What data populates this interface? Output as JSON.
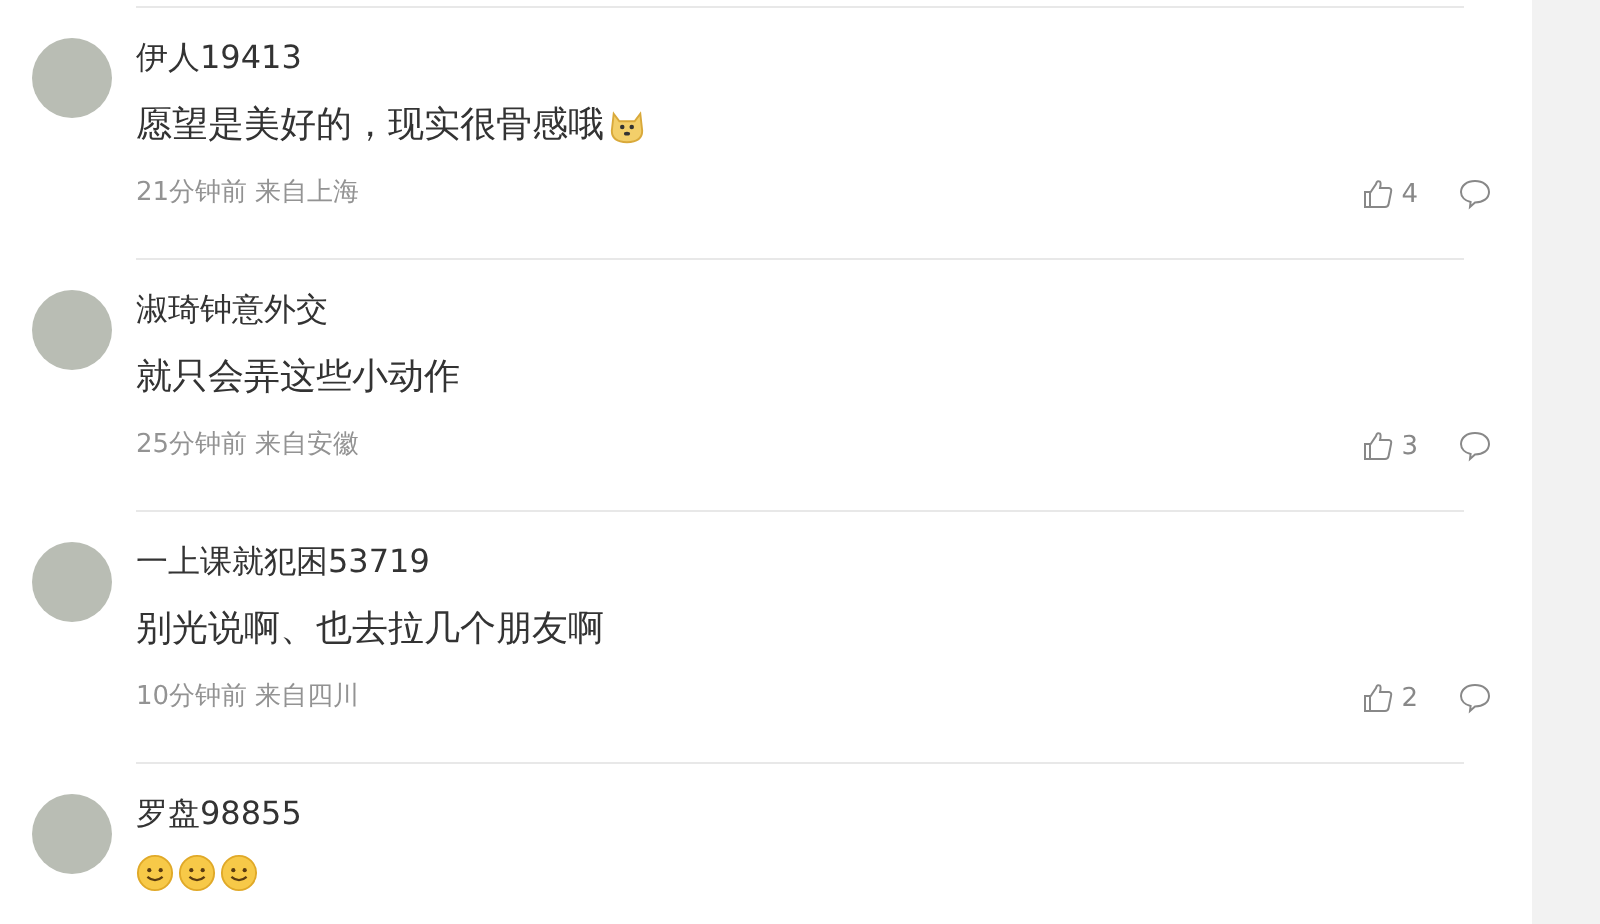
{
  "comments": [
    {
      "user": "伊人19413",
      "text": "愿望是美好的，现实很骨感哦",
      "emojis": [
        {
          "kind": "doge"
        }
      ],
      "meta": "21分钟前 来自上海",
      "likes": "4"
    },
    {
      "user": "淑琦钟意外交",
      "text": "就只会弄这些小动作",
      "meta": "25分钟前 来自安徽",
      "likes": "3"
    },
    {
      "user": "一上课就犯困53719",
      "text": "别光说啊、也去拉几个朋友啊",
      "meta": "10分钟前 来自四川",
      "likes": "2"
    },
    {
      "user": "罗盘98855",
      "emojis": [
        {
          "kind": "smile"
        },
        {
          "kind": "smile"
        },
        {
          "kind": "smile"
        }
      ]
    }
  ]
}
